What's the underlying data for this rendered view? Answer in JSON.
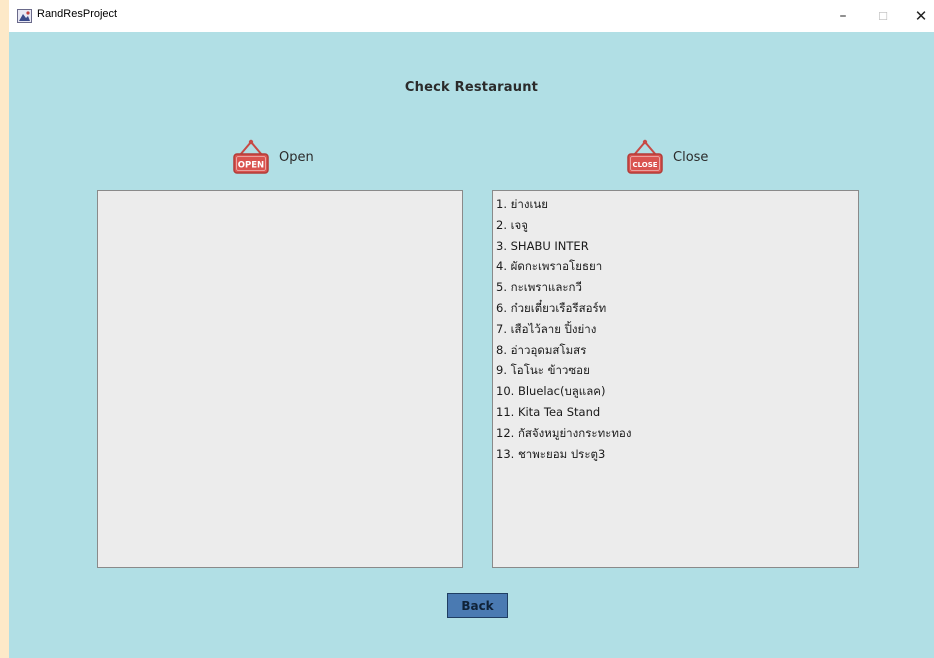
{
  "window": {
    "title": "RandResProject",
    "minimize_glyph": "–",
    "maximize_glyph": "☐",
    "close_glyph": "✕"
  },
  "heading": "Check Restaraunt",
  "open_section": {
    "label": "Open",
    "icon": "open-sign-icon",
    "sign_text": "OPEN",
    "items": []
  },
  "close_section": {
    "label": "Close",
    "icon": "close-sign-icon",
    "sign_text": "CLOSE",
    "items": [
      "1. ย่างเนย",
      "2. เจจู",
      "3. SHABU INTER",
      "4. ผัดกะเพราอโยธยา",
      "5. กะเพราและกวี",
      "6. ก๋วยเตี๋ยวเรือรีสอร์ท",
      "7. เสือไว้ลาย ปิ้งย่าง",
      "8. อ่าวอุดมสโมสร",
      "9. โอโนะ ข้าวซอย",
      "10. Bluelac(บลูแลค)",
      "11. Kita Tea Stand",
      "12. กัสจังหมูย่างกระทะทอง",
      "13. ชาพะยอม ประตู3"
    ]
  },
  "back_button": "Back",
  "colors": {
    "background": "#b1dfe5",
    "panel": "#ececec",
    "button": "#4a7ab2",
    "sign": "#d9534f"
  }
}
